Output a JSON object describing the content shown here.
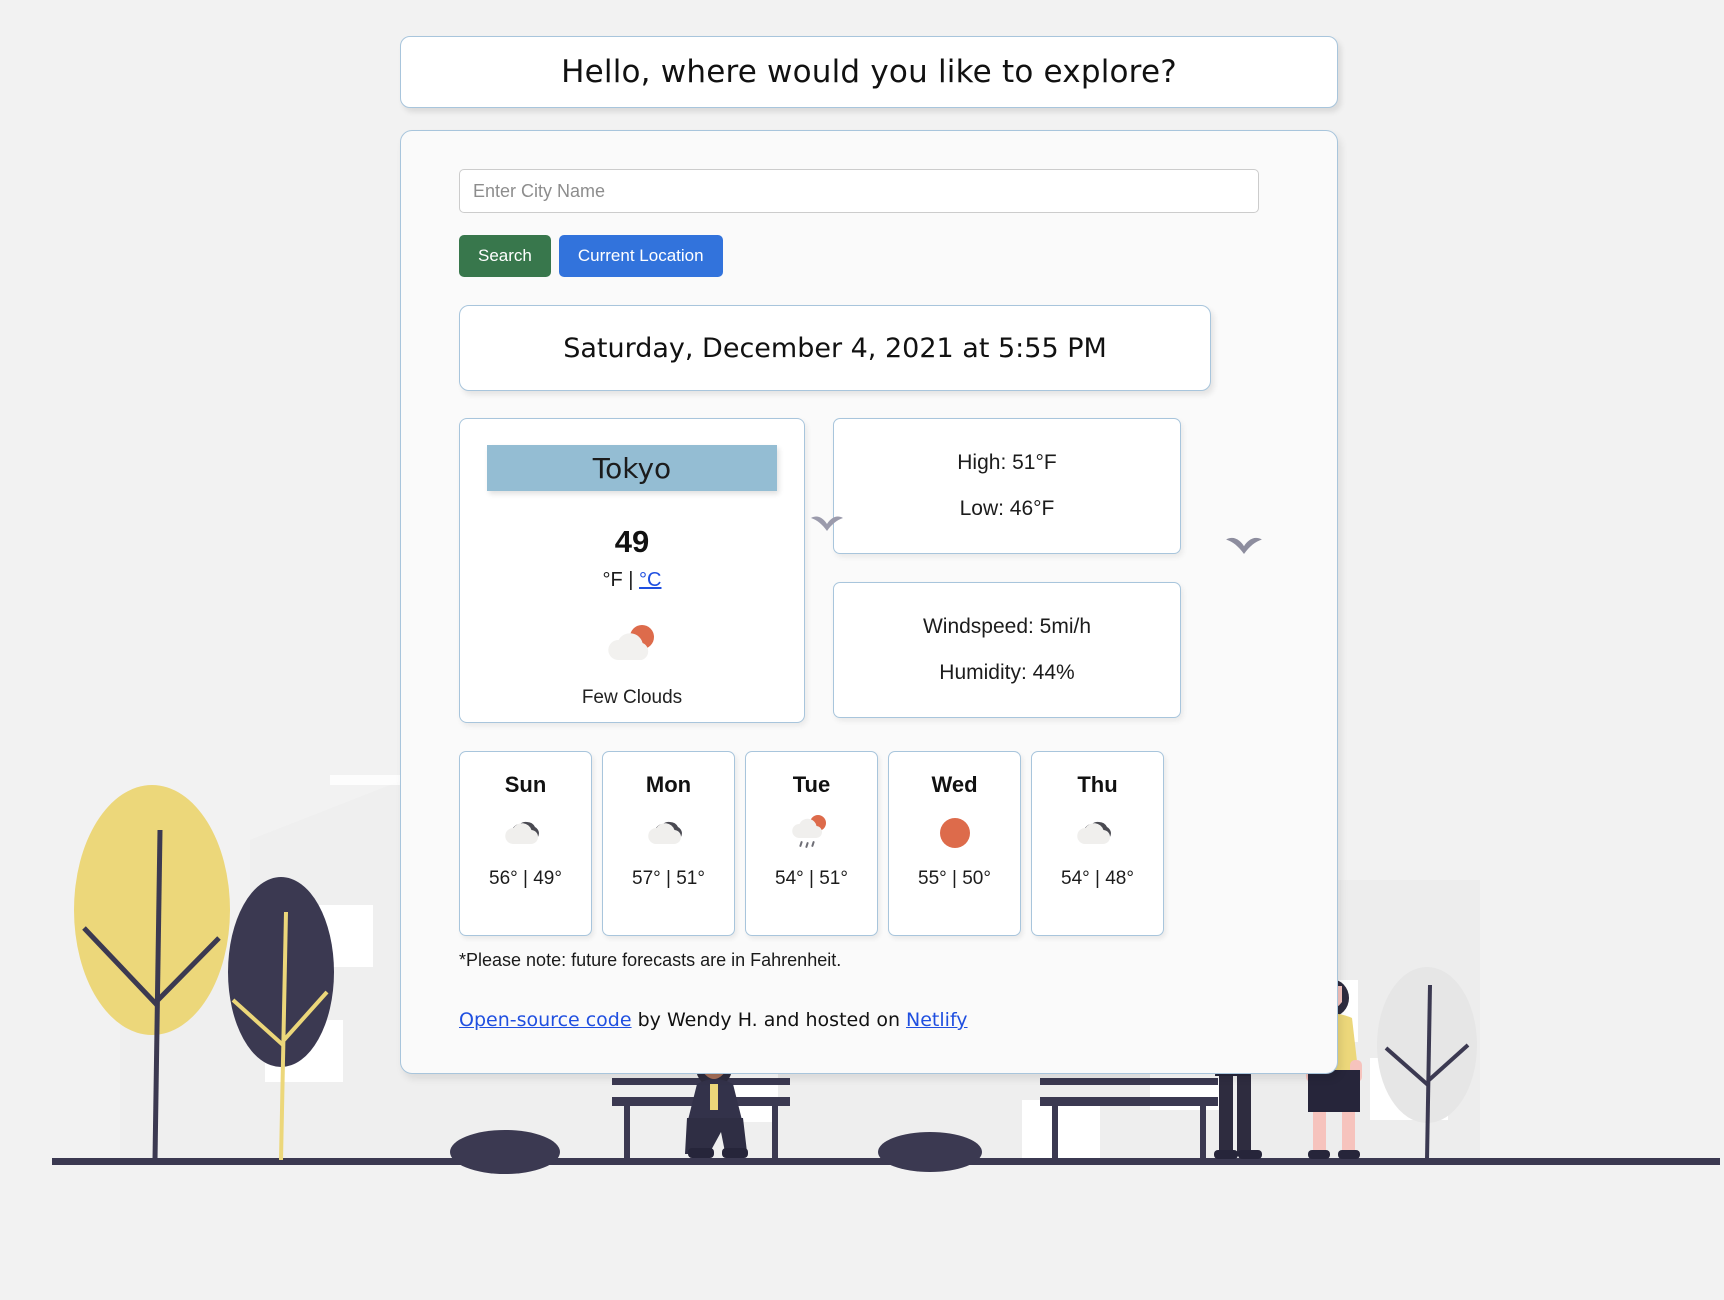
{
  "greeting": "Hello, where would you like to explore?",
  "search": {
    "placeholder": "Enter City Name",
    "value": "",
    "search_label": "Search",
    "location_label": "Current Location"
  },
  "datetime": "Saturday, December 4, 2021 at 5:55 PM",
  "current": {
    "city": "Tokyo",
    "temperature": "49",
    "unit_fahrenheit": "°F",
    "unit_separator": " | ",
    "unit_celsius": "°C",
    "condition": "Few Clouds",
    "condition_icon": "cloud-sun-icon",
    "high": "High: 51°F",
    "low": "Low: 46°F",
    "windspeed": "Windspeed: 5mi/h",
    "humidity": "Humidity: 44%"
  },
  "forecast": [
    {
      "day": "Sun",
      "icon": "broken-clouds-icon",
      "temps": "56° | 49°"
    },
    {
      "day": "Mon",
      "icon": "broken-clouds-icon",
      "temps": "57° | 51°"
    },
    {
      "day": "Tue",
      "icon": "sun-cloud-rain-icon",
      "temps": "54° | 51°"
    },
    {
      "day": "Wed",
      "icon": "clear-sun-icon",
      "temps": "55° | 50°"
    },
    {
      "day": "Thu",
      "icon": "broken-clouds-icon",
      "temps": "54° | 48°"
    }
  ],
  "note": "*Please note: future forecasts are in Fahrenheit.",
  "credits": {
    "link_code": "Open-source code",
    "middle": " by Wendy H. and hosted on ",
    "link_host": "Netlify"
  },
  "colors": {
    "page_bg": "#f2f2f2",
    "card_border": "#a8c5dc",
    "city_highlight": "#94bdd3",
    "search_button": "#38774c",
    "location_button": "#3273dc",
    "link": "#1f4fe0",
    "sun_orange": "#dd6b4b",
    "cloud_light": "#f2f1ef",
    "cloud_dark": "#4a4a52",
    "tree_yellow": "#ecd77a",
    "tree_navy": "#3b3951",
    "skin": "#f6c3bd"
  }
}
